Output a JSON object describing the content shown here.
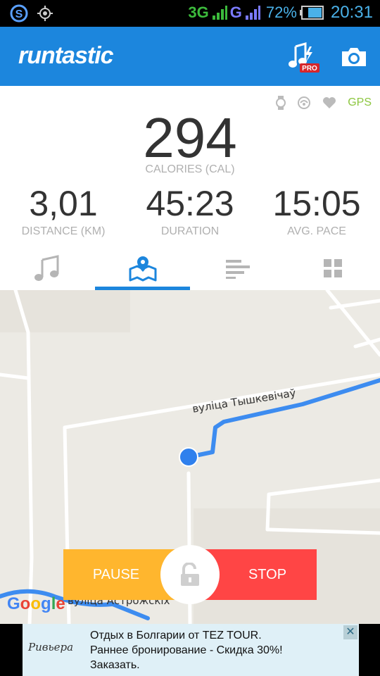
{
  "status_bar": {
    "network_3g": "3G",
    "network_g": "G",
    "battery_percent": "72%",
    "time": "20:31"
  },
  "app_bar": {
    "logo": "runtastic",
    "pro_badge": "PRO"
  },
  "stats": {
    "gps_label": "GPS",
    "calories": {
      "value": "294",
      "label": "CALORIES (CAL)"
    },
    "distance": {
      "value": "3,01",
      "label": "DISTANCE (KM)"
    },
    "duration": {
      "value": "45:23",
      "label": "DURATION"
    },
    "avg_pace": {
      "value": "15:05",
      "label": "AVG. PACE"
    }
  },
  "tabs": [
    "music-note-icon",
    "map-icon",
    "bar-list-icon",
    "grid-icon"
  ],
  "active_tab": 1,
  "map": {
    "street_1": "вуліца Тышкевічаў",
    "street_2": "вуліца Астрожскіх",
    "provider": "Google"
  },
  "controls": {
    "pause_label": "PAUSE",
    "stop_label": "STOP"
  },
  "ad": {
    "logo_text": "Ривьера",
    "text": "Отдых в Болгарии от TEZ TOUR. Раннее бронирование - Скидка 30%! Заказать.",
    "close": "✕"
  },
  "colors": {
    "brand_blue": "#1c86dd",
    "pause_yellow": "#ffb62e",
    "stop_red": "#ff4545",
    "gps_green": "#8cc63f",
    "route_blue": "#3d8cf0"
  }
}
